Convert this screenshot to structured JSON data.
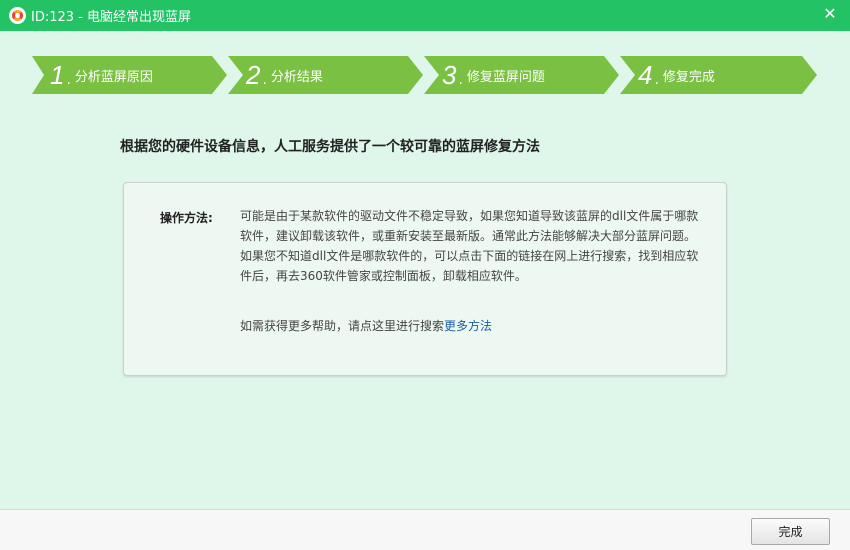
{
  "window": {
    "title": "ID:123 - 电脑经常出现蓝屏",
    "close_symbol": "✕"
  },
  "steps": [
    {
      "number": "1",
      "dot": ".",
      "label": "分析蓝屏原因"
    },
    {
      "number": "2",
      "dot": ".",
      "label": "分析结果"
    },
    {
      "number": "3",
      "dot": ".",
      "label": "修复蓝屏问题"
    },
    {
      "number": "4",
      "dot": ".",
      "label": "修复完成"
    }
  ],
  "main": {
    "headline": "根据您的硬件设备信息，人工服务提供了一个较可靠的蓝屏修复方法",
    "method_label": "操作方法:",
    "method_text": "可能是由于某款软件的驱动文件不稳定导致，如果您知道导致该蓝屏的dll文件属于哪款软件，建议卸载该软件，或重新安装至最新版。通常此方法能够解决大部分蓝屏问题。如果您不知道dll文件是哪款软件的，可以点击下面的链接在网上进行搜索，找到相应软件后，再去360软件管家或控制面板，卸载相应软件。",
    "help_prefix": "如需获得更多帮助，请点这里进行搜索",
    "help_link": "更多方法"
  },
  "footer": {
    "finish_label": "完成"
  },
  "colors": {
    "titlebar": "#22c265",
    "step_active": "#7ac143",
    "background": "#dff6ea",
    "link": "#1a5fa8"
  },
  "icons": {
    "app": "lifebuoy-icon",
    "close": "close-icon"
  }
}
